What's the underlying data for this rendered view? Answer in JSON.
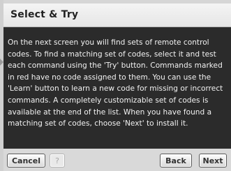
{
  "dialog": {
    "title": "Select & Try",
    "body": "On the next screen you will find sets of remote control codes. To find a matching set of codes, select it and test each command using the 'Try' button. Commands marked in red have no code assigned to them. You can use the 'Learn' button to learn a new code for missing or incorrect commands. A completely customizable set of codes is available at the end of the list. When you have found a matching set of codes, choose 'Next' to install it."
  },
  "footer": {
    "cancel_label": "Cancel",
    "help_label": "?",
    "back_label": "Back",
    "next_label": "Next"
  }
}
